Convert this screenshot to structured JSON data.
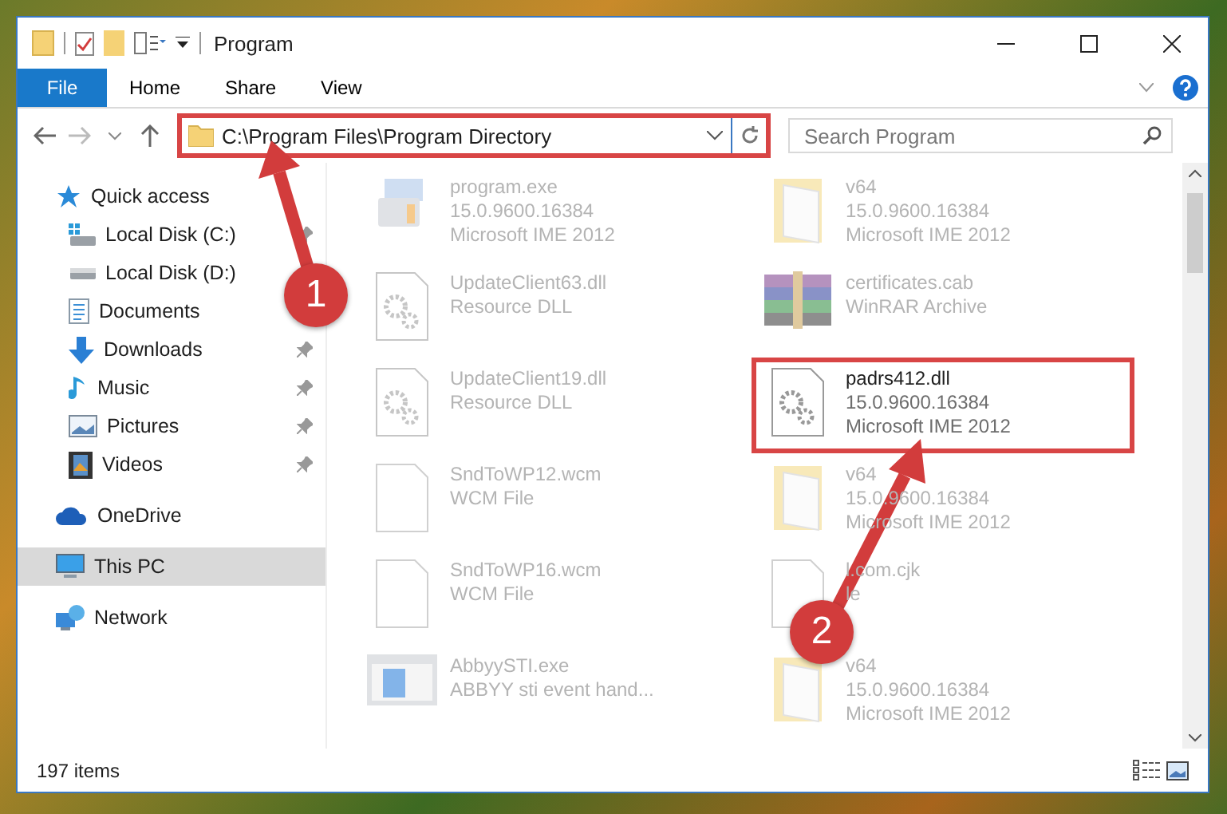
{
  "window": {
    "title": "Program"
  },
  "ribbon": {
    "file_tab": "File",
    "tabs": [
      "Home",
      "Share",
      "View"
    ]
  },
  "address": {
    "path": "C:\\Program Files\\Program Directory",
    "highlighted": true
  },
  "search": {
    "placeholder": "Search Program"
  },
  "sidebar": {
    "items": [
      {
        "label": "Quick access",
        "kind": "star",
        "selected": false,
        "children": [
          {
            "label": "Local Disk (C:)",
            "kind": "drive-win",
            "pinned": true,
            "selected": false
          },
          {
            "label": "Local Disk (D:)",
            "kind": "drive",
            "selected": false
          },
          {
            "label": "Documents",
            "kind": "document",
            "selected": false
          },
          {
            "label": "Downloads",
            "kind": "download",
            "pinned": true,
            "selected": false
          },
          {
            "label": "Music",
            "kind": "music",
            "pinned": true,
            "selected": false
          },
          {
            "label": "Pictures",
            "kind": "picture",
            "pinned": true,
            "selected": false
          },
          {
            "label": "Videos",
            "kind": "video",
            "pinned": true,
            "selected": false
          }
        ]
      },
      {
        "label": "OneDrive",
        "kind": "cloud",
        "selected": false
      },
      {
        "label": "This PC",
        "kind": "pc",
        "selected": true
      },
      {
        "label": "Network",
        "kind": "network",
        "selected": false
      }
    ]
  },
  "files": [
    {
      "name": "program.exe",
      "details": [
        "15.0.9600.16384",
        "Microsoft IME 2012"
      ],
      "kind": "exe",
      "dimmed": true,
      "highlighted": false
    },
    {
      "name": "v64",
      "details": [
        "15.0.9600.16384",
        "Microsoft IME 2012"
      ],
      "kind": "folder",
      "dimmed": true,
      "highlighted": false
    },
    {
      "name": "UpdateClient63.dll",
      "details": [
        "Resource DLL"
      ],
      "kind": "dll",
      "dimmed": true,
      "highlighted": false
    },
    {
      "name": "certificates.cab",
      "details": [
        "WinRAR Archive"
      ],
      "kind": "archive",
      "dimmed": true,
      "highlighted": false
    },
    {
      "name": "UpdateClient19.dll",
      "details": [
        "Resource DLL"
      ],
      "kind": "dll",
      "dimmed": true,
      "highlighted": false
    },
    {
      "name": "padrs412.dll",
      "details": [
        "15.0.9600.16384",
        "Microsoft IME 2012"
      ],
      "kind": "dll",
      "dimmed": false,
      "highlighted": true
    },
    {
      "name": "SndToWP12.wcm",
      "details": [
        "WCM File"
      ],
      "kind": "file",
      "dimmed": true,
      "highlighted": false
    },
    {
      "name": "v64",
      "details": [
        "15.0.9600.16384",
        "Microsoft IME 2012"
      ],
      "kind": "folder",
      "dimmed": true,
      "highlighted": false
    },
    {
      "name": "SndToWP16.wcm",
      "details": [
        "WCM File"
      ],
      "kind": "file",
      "dimmed": true,
      "highlighted": false
    },
    {
      "name": "l.com.cjk",
      "details": [
        "le"
      ],
      "kind": "file",
      "dimmed": true,
      "highlighted": false
    },
    {
      "name": "AbbyySTI.exe",
      "details": [
        "ABBYY sti event hand..."
      ],
      "kind": "app",
      "dimmed": true,
      "highlighted": false
    },
    {
      "name": "v64",
      "details": [
        "15.0.9600.16384",
        "Microsoft IME 2012"
      ],
      "kind": "folder",
      "dimmed": true,
      "highlighted": false
    }
  ],
  "status_bar": {
    "item_count": "197 items"
  },
  "annotations": [
    {
      "label": "1"
    },
    {
      "label": "2"
    }
  ]
}
